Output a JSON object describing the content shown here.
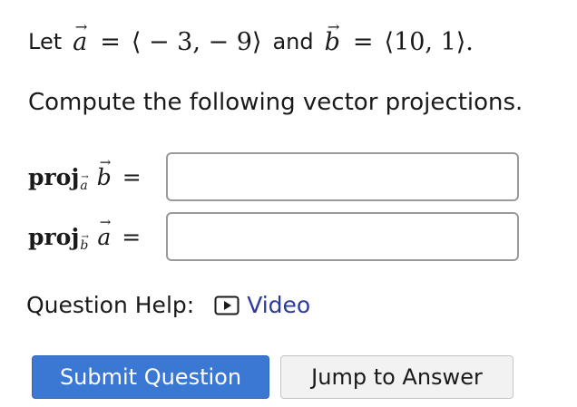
{
  "question": {
    "intro": "Let",
    "vector_a_name": "a",
    "vector_b_name": "b",
    "equals": "=",
    "vector_a_value": "⟨ − 3,  − 9⟩",
    "conjunction": "and",
    "vector_b_value": "⟨10, 1⟩.",
    "instruction": "Compute the following vector projections.",
    "proj_word": "proj",
    "arrow_glyph": "→",
    "rows": [
      {
        "sub": "a",
        "target": "b"
      },
      {
        "sub": "b",
        "target": "a"
      }
    ],
    "answer_1": "",
    "answer_2": ""
  },
  "help": {
    "label": "Question Help:",
    "video_label": "Video",
    "video_icon": "play-video-icon"
  },
  "buttons": {
    "submit_label": "Submit Question",
    "jump_label": "Jump to Answer"
  },
  "colors": {
    "submit_bg": "#3a78d4",
    "link": "#2b3a9e",
    "jump_bg": "#f2f2f2"
  }
}
